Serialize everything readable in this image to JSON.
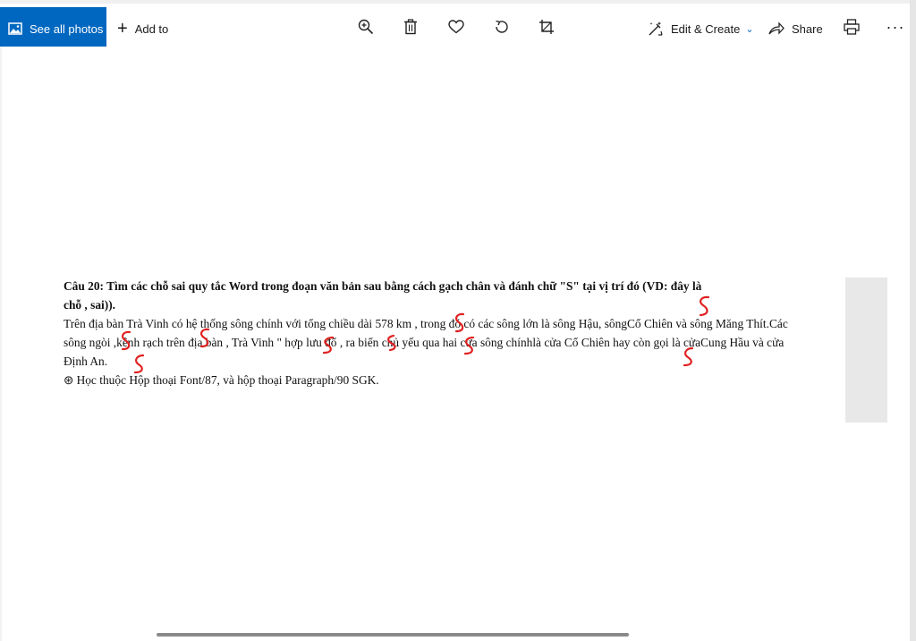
{
  "toolbar": {
    "see_all_label": "See all photos",
    "add_to_label": "Add to",
    "edit_create_label": "Edit & Create",
    "share_label": "Share",
    "more_label": "···"
  },
  "document": {
    "question_line1": "Câu  20: Tìm các chỗ sai quy tắc Word trong đoạn văn bản sau bằng cách gạch chân và đánh chữ \"S\" tại vị trí đó (VD: đây là",
    "question_line2": "chỗ   , sai)).",
    "paragraph": "Trên địa bàn Trà Vinh có hệ thống sông chính với tổng chiều dài 578 km , trong đó có các sông lớn là sông Hậu, sôngCổ Chiên và sông Măng Thít.Các sông ngòi ,kênh rạch trên địa bàn , Trà Vinh \" hợp lưu đổ , ra biển chủ yếu qua hai cửa sông chínhlà cửa Cổ Chiên hay còn gọi là cửaCung Hầu và cửa Định An.",
    "note": "⊛ Học thuộc Hộp thoại Font/87, và hộp thoại Paragraph/90 SGK."
  },
  "colors": {
    "accent": "#0067c0",
    "annotation_red": "#e02020"
  }
}
